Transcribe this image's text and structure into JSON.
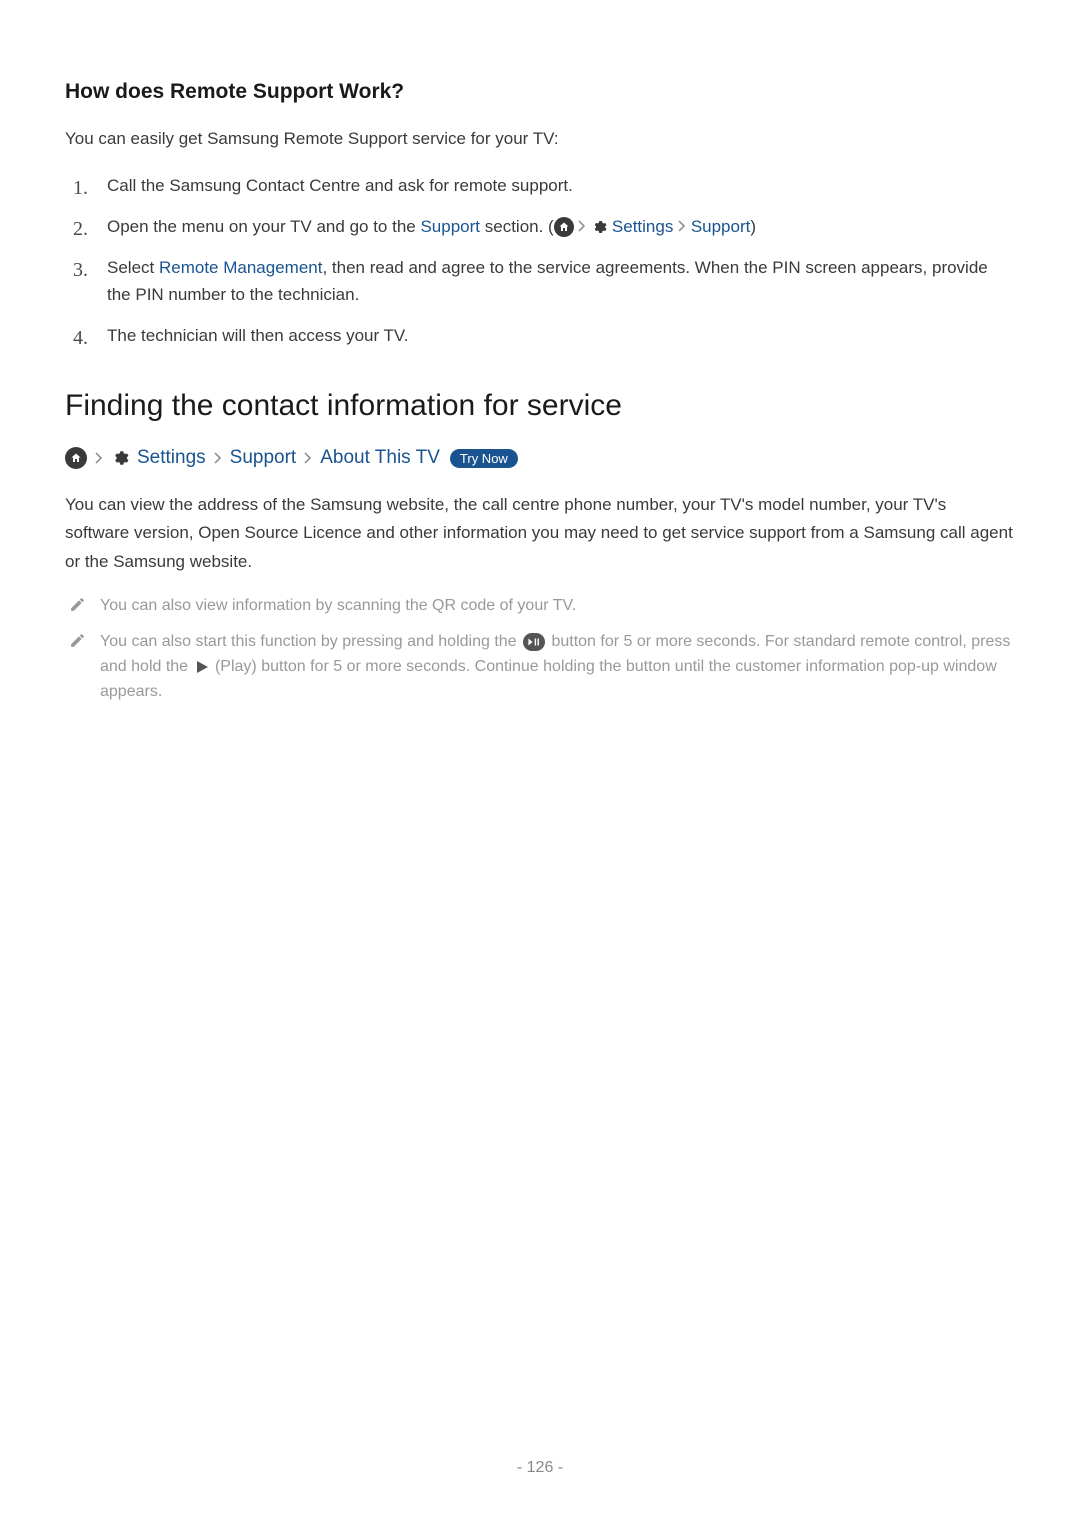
{
  "subsection1": {
    "heading": "How does Remote Support Work?",
    "intro": "You can easily get Samsung Remote Support service for your TV:",
    "steps": {
      "s1": "Call the Samsung Contact Centre and ask for remote support.",
      "s2_pre": "Open the menu on your TV and go to the ",
      "s2_link1": "Support",
      "s2_mid": " section. (",
      "s2_settings": " Settings",
      "s2_support": "Support",
      "s2_post": ")",
      "s3_pre": "Select ",
      "s3_link": "Remote Management",
      "s3_post": ", then read and agree to the service agreements. When the PIN screen appears, provide the PIN number to the technician.",
      "s4": "The technician will then access your TV."
    }
  },
  "section2": {
    "heading": "Finding the contact information for service",
    "path": {
      "settings": " Settings",
      "support": "Support",
      "about": "About This TV",
      "try_now": "Try Now"
    },
    "body": "You can view the address of the Samsung website, the call centre phone number, your TV's model number, your TV's software version, Open Source Licence and other information you may need to get service support from a Samsung call agent or the Samsung website.",
    "note1": "You can also view information by scanning the QR code of your TV.",
    "note2_pre": "You can also start this function by pressing and holding the ",
    "note2_mid": " button for 5 or more seconds. For standard remote control, press and hold the ",
    "note2_post": " (Play) button for 5 or more seconds. Continue holding the button until the customer information pop-up window appears."
  },
  "page_number": "- 126 -"
}
